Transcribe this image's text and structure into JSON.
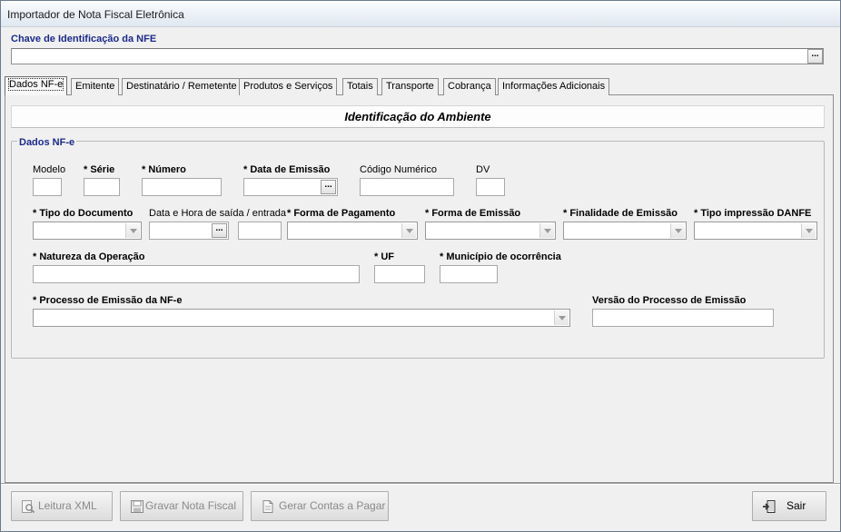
{
  "window": {
    "title": "Importador de Nota Fiscal Eletrônica"
  },
  "chave": {
    "label": "Chave de Identificação da NFE",
    "value": "",
    "button": "..."
  },
  "tabs": [
    {
      "label": "Dados NF-e",
      "active": true
    },
    {
      "label": "Emitente"
    },
    {
      "label": "Destinatário / Remetente"
    },
    {
      "label": "Produtos e Serviços"
    },
    {
      "label": "Totais"
    },
    {
      "label": "Transporte"
    },
    {
      "label": "Cobrança"
    },
    {
      "label": "Informações Adicionais"
    }
  ],
  "ambiente": {
    "header": "Identificação do Ambiente"
  },
  "group": {
    "legend": "Dados NF-e",
    "labels": {
      "modelo": "Modelo",
      "serie": "* Série",
      "numero": "* Número",
      "data_emissao": "* Data de Emissão",
      "codigo_numerico": "Código Numérico",
      "dv": "DV",
      "tipo_documento": "* Tipo do Documento",
      "data_hora_saida": "Data e Hora de saída / entrada",
      "forma_pagamento": "* Forma de Pagamento",
      "forma_emissao": "* Forma de Emissão",
      "finalidade_emissao": "* Finalidade de Emissão",
      "tipo_impressao": "* Tipo impressão DANFE",
      "natureza_operacao": "* Natureza da Operação",
      "uf": "* UF",
      "municipio": "* Município de ocorrência",
      "processo_emissao": "* Processo de Emissão da NF-e",
      "versao_processo": "Versão do Processo de Emissão"
    },
    "ellipsis": "..."
  },
  "buttons": {
    "leitura_xml": "Leitura XML",
    "gravar_nota": "Gravar Nota Fiscal",
    "gerar_contas": "Gerar Contas a Pagar",
    "sair": "Sair"
  }
}
